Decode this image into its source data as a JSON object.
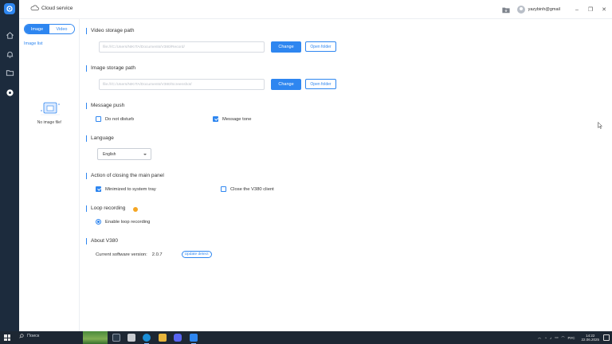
{
  "topbar": {
    "cloud_label": "Cloud service",
    "user_email": "yazybinh@gmail",
    "minimize": "–",
    "maximize": "❐",
    "close": "✕"
  },
  "left_panel": {
    "tabs": [
      {
        "label": "Image",
        "active": true
      },
      {
        "label": "Video",
        "active": false
      }
    ],
    "list_title": "Image list",
    "empty_text": "No image file!"
  },
  "settings": {
    "video_storage": {
      "title": "Video storage path",
      "path": "file:///C:/Users/NIKITA/Documents/V380/Record/",
      "change_label": "Change",
      "open_label": "Open folder"
    },
    "image_storage": {
      "title": "Image storage path",
      "path": "file:///C:/Users/NIKITA/Documents/V380/Screenshot/",
      "change_label": "Change",
      "open_label": "Open folder"
    },
    "message_push": {
      "title": "Message push",
      "do_not_disturb": {
        "label": "Do not disturb",
        "checked": false
      },
      "message_tone": {
        "label": "Message tone",
        "checked": true
      }
    },
    "language": {
      "title": "Language",
      "selected": "English"
    },
    "closing_action": {
      "title": "Action of closing the main panel",
      "minimize": {
        "label": "Minimized to system tray",
        "checked": true
      },
      "close_client": {
        "label": "Close the V380 client",
        "checked": false
      }
    },
    "loop_recording": {
      "title": "Loop recording",
      "enable": {
        "label": "Enable loop recording",
        "selected": true
      }
    },
    "about": {
      "title": "About V380",
      "version_label": "Current software version:",
      "version_value": "2.0.7",
      "update_label": "Update detect"
    }
  },
  "taskbar": {
    "search_label": "Поиск",
    "language": "РУС",
    "time": "14:22",
    "date": "22.06.2025"
  },
  "colors": {
    "accent": "#2e86f0",
    "rail": "#1c2b3d",
    "warning": "#f5a623",
    "taskbar": "#1d2733"
  }
}
